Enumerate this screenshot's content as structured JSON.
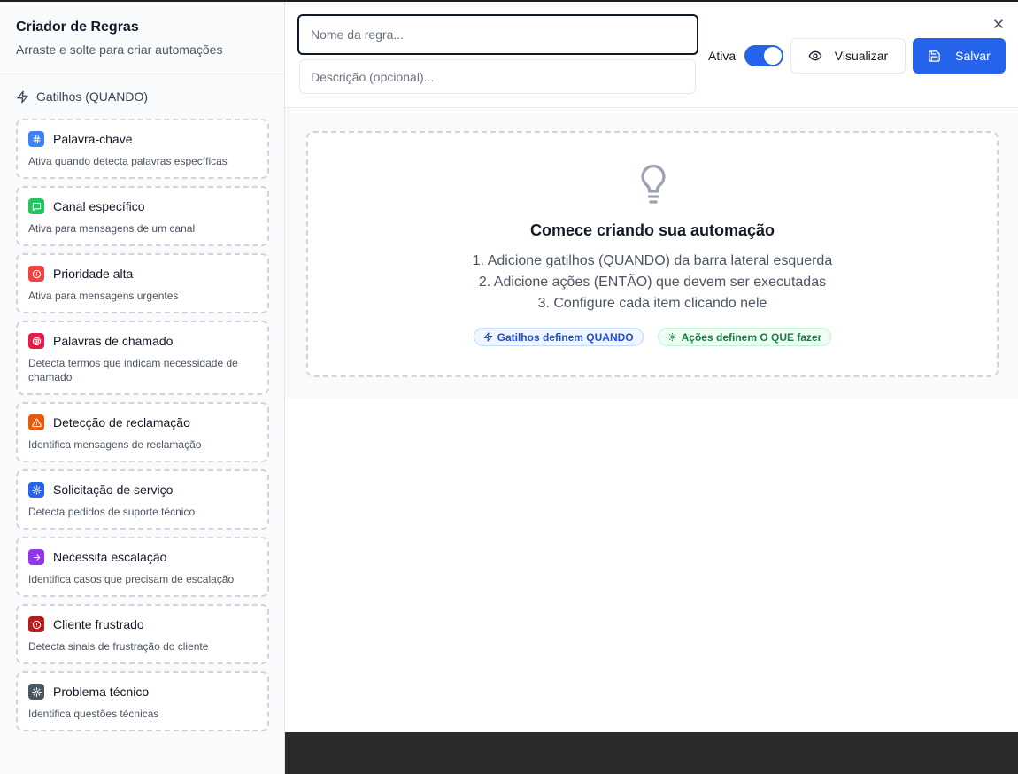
{
  "sidebar": {
    "title": "Criador de Regras",
    "subtitle": "Arraste e solte para criar automações",
    "section_label": "Gatilhos (QUANDO)",
    "section_icon": "zap-icon",
    "triggers": [
      {
        "title": "Palavra-chave",
        "desc": "Ativa quando detecta palavras específicas",
        "icon": "hash-icon",
        "color": "#3b82f6"
      },
      {
        "title": "Canal específico",
        "desc": "Ativa para mensagens de um canal",
        "icon": "message-square-icon",
        "color": "#22c55e"
      },
      {
        "title": "Prioridade alta",
        "desc": "Ativa para mensagens urgentes",
        "icon": "alert-circle-icon",
        "color": "#ef4444"
      },
      {
        "title": "Palavras de chamado",
        "desc": "Detecta termos que indicam necessidade de chamado",
        "icon": "target-icon",
        "color": "#e11d48"
      },
      {
        "title": "Detecção de reclamação",
        "desc": "Identifica mensagens de reclamação",
        "icon": "alert-triangle-icon",
        "color": "#ea580c"
      },
      {
        "title": "Solicitação de serviço",
        "desc": "Detecta pedidos de suporte técnico",
        "icon": "cog-icon",
        "color": "#2563eb"
      },
      {
        "title": "Necessita escalação",
        "desc": "Identifica casos que precisam de escalação",
        "icon": "arrow-right-icon",
        "color": "#9333ea"
      },
      {
        "title": "Cliente frustrado",
        "desc": "Detecta sinais de frustração do cliente",
        "icon": "alert-circle-icon",
        "color": "#b91c1c"
      },
      {
        "title": "Problema técnico",
        "desc": "Identifica questões técnicas",
        "icon": "settings-icon",
        "color": "#4b5563"
      }
    ]
  },
  "header": {
    "name_placeholder": "Nome da regra...",
    "name_value": "",
    "description_placeholder": "Descrição (opcional)...",
    "description_value": "",
    "active_label": "Ativa",
    "active": true,
    "preview_label": "Visualizar",
    "save_label": "Salvar"
  },
  "empty_state": {
    "icon": "lightbulb-icon",
    "title": "Comece criando sua automação",
    "steps": [
      "1. Adicione gatilhos (QUANDO) da barra lateral esquerda",
      "2. Adicione ações (ENTÃO) que devem ser executadas",
      "3. Configure cada item clicando nele"
    ],
    "chip_triggers": "Gatilhos definem QUANDO",
    "chip_actions": "Ações definem O QUE fazer"
  },
  "colors": {
    "primary": "#2563eb",
    "chip_blue_text": "#1d4ed8",
    "chip_green_text": "#15803d"
  }
}
